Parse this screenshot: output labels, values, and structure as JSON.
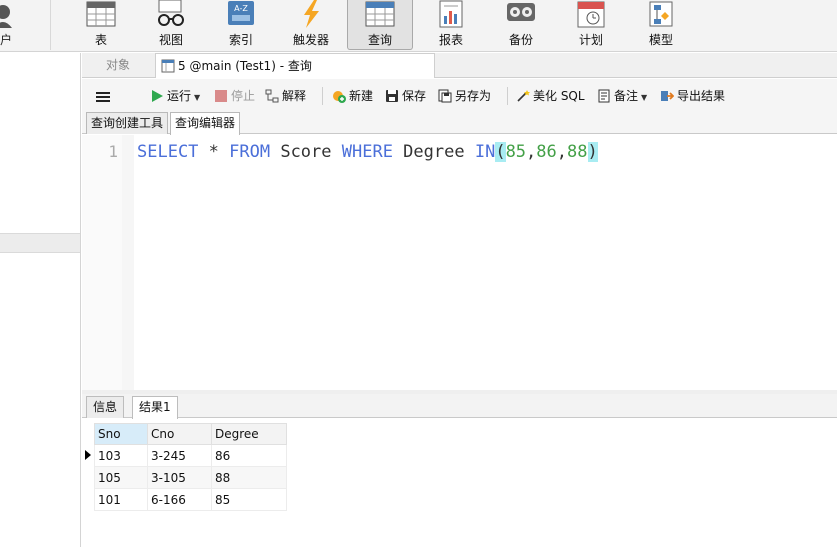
{
  "ribbon": {
    "user_partial_label": "户",
    "buttons": [
      {
        "label": "表",
        "icon": "table-icon"
      },
      {
        "label": "视图",
        "icon": "glasses-icon"
      },
      {
        "label": "索引",
        "icon": "index-icon"
      },
      {
        "label": "触发器",
        "icon": "lightning-icon"
      },
      {
        "label": "查询",
        "icon": "query-grid-icon",
        "active": true
      },
      {
        "label": "报表",
        "icon": "report-icon"
      },
      {
        "label": "备份",
        "icon": "backup-icon"
      },
      {
        "label": "计划",
        "icon": "calendar-icon"
      },
      {
        "label": "模型",
        "icon": "model-icon"
      }
    ]
  },
  "doc_tabs": {
    "objects_label": "对象",
    "active_label": "5 @main (Test1) - 查询"
  },
  "query_toolbar": {
    "run": "运行",
    "stop": "停止",
    "explain": "解释",
    "new": "新建",
    "save": "保存",
    "save_as": "另存为",
    "beautify": "美化 SQL",
    "comment": "备注",
    "export": "导出结果"
  },
  "sub_tabs": {
    "builder": "查询创建工具",
    "editor": "查询编辑器"
  },
  "editor": {
    "line_number": "1",
    "tokens": {
      "select": "SELECT",
      "star": " * ",
      "from": "FROM",
      "table": " Score ",
      "where": "WHERE",
      "column": " Degree ",
      "in": "IN",
      "open_paren": "(",
      "v1": "85",
      "comma1": ",",
      "v2": "86",
      "comma2": ",",
      "v3": "88",
      "close_paren": ")"
    }
  },
  "result_tabs": {
    "info": "信息",
    "result1": "结果1"
  },
  "result_grid": {
    "columns": [
      "Sno",
      "Cno",
      "Degree"
    ],
    "rows": [
      [
        "103",
        "3-245",
        "86"
      ],
      [
        "105",
        "3-105",
        "88"
      ],
      [
        "101",
        "6-166",
        "85"
      ]
    ]
  },
  "colors": {
    "keyword": "#4b6fd9",
    "number": "#43a047",
    "paren_highlight": "#a8ecf2",
    "run_green": "#2fa84f",
    "stop_red": "#d98a8a"
  }
}
